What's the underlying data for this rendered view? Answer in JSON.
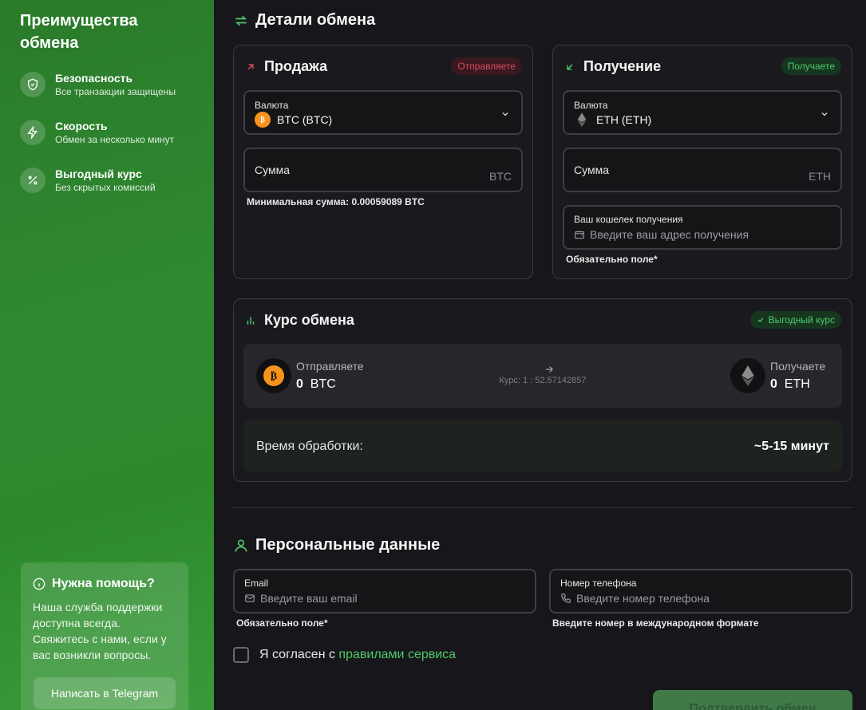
{
  "sidebar": {
    "title": "Преимущества обмена",
    "features": [
      {
        "title": "Безопасность",
        "subtitle": "Все транзакции защищены",
        "icon": "shield-icon"
      },
      {
        "title": "Скорость",
        "subtitle": "Обмен за несколько минут",
        "icon": "lightning-icon"
      },
      {
        "title": "Выгодный курс",
        "subtitle": "Без скрытых комиссий",
        "icon": "percent-icon"
      }
    ],
    "help": {
      "title": "Нужна помощь?",
      "text": "Наша служба поддержки доступна всегда. Свяжитесь с нами, если у вас возникли вопросы.",
      "button": "Написать в Telegram"
    }
  },
  "exchange": {
    "title": "Детали обмена",
    "sell": {
      "title": "Продажа",
      "badge": "Отправляете",
      "currency_label": "Валюта",
      "currency_value": "BTC (BTC)",
      "amount_label": "Сумма",
      "amount_unit": "BTC",
      "min_hint": "Минимальная сумма: 0.00059089 BTC"
    },
    "receive": {
      "title": "Получение",
      "badge": "Получаете",
      "currency_label": "Валюта",
      "currency_value": "ETH (ETH)",
      "amount_label": "Сумма",
      "amount_unit": "ETH",
      "wallet_label": "Ваш кошелек получения",
      "wallet_placeholder": "Введите ваш адрес получения",
      "required_hint": "Обязательно поле*"
    }
  },
  "rate": {
    "title": "Курс обмена",
    "badge": "Выгодный курс",
    "send_label": "Отправляете",
    "send_value": "0",
    "send_unit": "BTC",
    "receive_label": "Получаете",
    "receive_value": "0",
    "receive_unit": "ETH",
    "rate_text": "Курс: 1 : 52.57142857",
    "time_label": "Время обработки:",
    "time_value": "~5-15 минут"
  },
  "personal": {
    "title": "Персональные данные",
    "email_label": "Email",
    "email_placeholder": "Введите ваш email",
    "email_hint": "Обязательно поле*",
    "phone_label": "Номер телефона",
    "phone_placeholder": "Введите номер телефона",
    "phone_hint": "Введите номер в международном формате",
    "agree_text": "Я согласен с ",
    "agree_link": "правилами сервиса"
  },
  "confirm_button": "Подтвердить обмен",
  "colors": {
    "accent": "#2e8b30",
    "green_text": "#4fc96a",
    "red_badge": "#d8495f",
    "btc": "#f7931a"
  }
}
